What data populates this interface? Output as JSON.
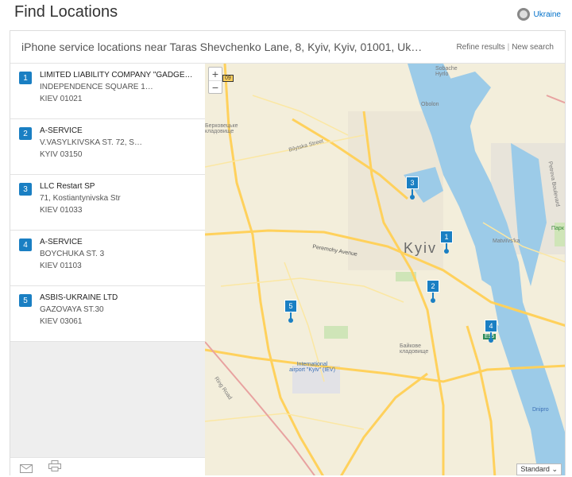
{
  "page_title": "Find Locations",
  "country_link": "Ukraine",
  "header": {
    "query": "iPhone service locations near Taras Shevchenko Lane, 8, Kyiv, Kyiv, 01001, Uk…",
    "refine": "Refine results",
    "separator": "|",
    "new_search": "New search"
  },
  "locations": [
    {
      "num": "1",
      "name": "LIMITED LIABILITY COMPANY \"GADGE…",
      "street": "INDEPENDENCE SQUARE 1…",
      "city": "KIEV 01021"
    },
    {
      "num": "2",
      "name": "A-SERVICE",
      "street": "V.VASYLKIVSKA ST. 72, S…",
      "city": "KYIV 03150"
    },
    {
      "num": "3",
      "name": "LLC Restart SP",
      "street": "71, Kostiantynivska Str",
      "city": "KIEV 01033"
    },
    {
      "num": "4",
      "name": "A-SERVICE",
      "street": "BOYCHUKA ST. 3",
      "city": "KIEV 01103"
    },
    {
      "num": "5",
      "name": "ASBIS-UKRAINE LTD",
      "street": "GAZOVAYA ST.30",
      "city": "KIEV 03061"
    }
  ],
  "map": {
    "zoom_in": "+",
    "zoom_out": "−",
    "city_label": "Kyiv",
    "labels": {
      "sobache": "Sobache Hyrlo",
      "obolon": "Obolon",
      "berk": "Беркoвецьке кладовище",
      "bilytska": "Bilytska Street",
      "peremohy": "Peremohy Avenue",
      "matvi": "Matviïvs'ka",
      "park": "Парк",
      "petrov": "Petrova Boulevard",
      "baikove": "Байкове кладовище",
      "airport": "International airport \"Kyiv\" (IEV)",
      "dnipro": "Dnipro",
      "route": "E95",
      "shield": "09",
      "road": "Ring Road"
    },
    "map_type": "Standard"
  },
  "icons": {
    "mail": "mail-icon",
    "print": "print-icon",
    "globe": "globe-icon"
  },
  "colors": {
    "accent": "#1a7fc3",
    "water": "#9ccbe8",
    "road": "#ffd15c"
  }
}
